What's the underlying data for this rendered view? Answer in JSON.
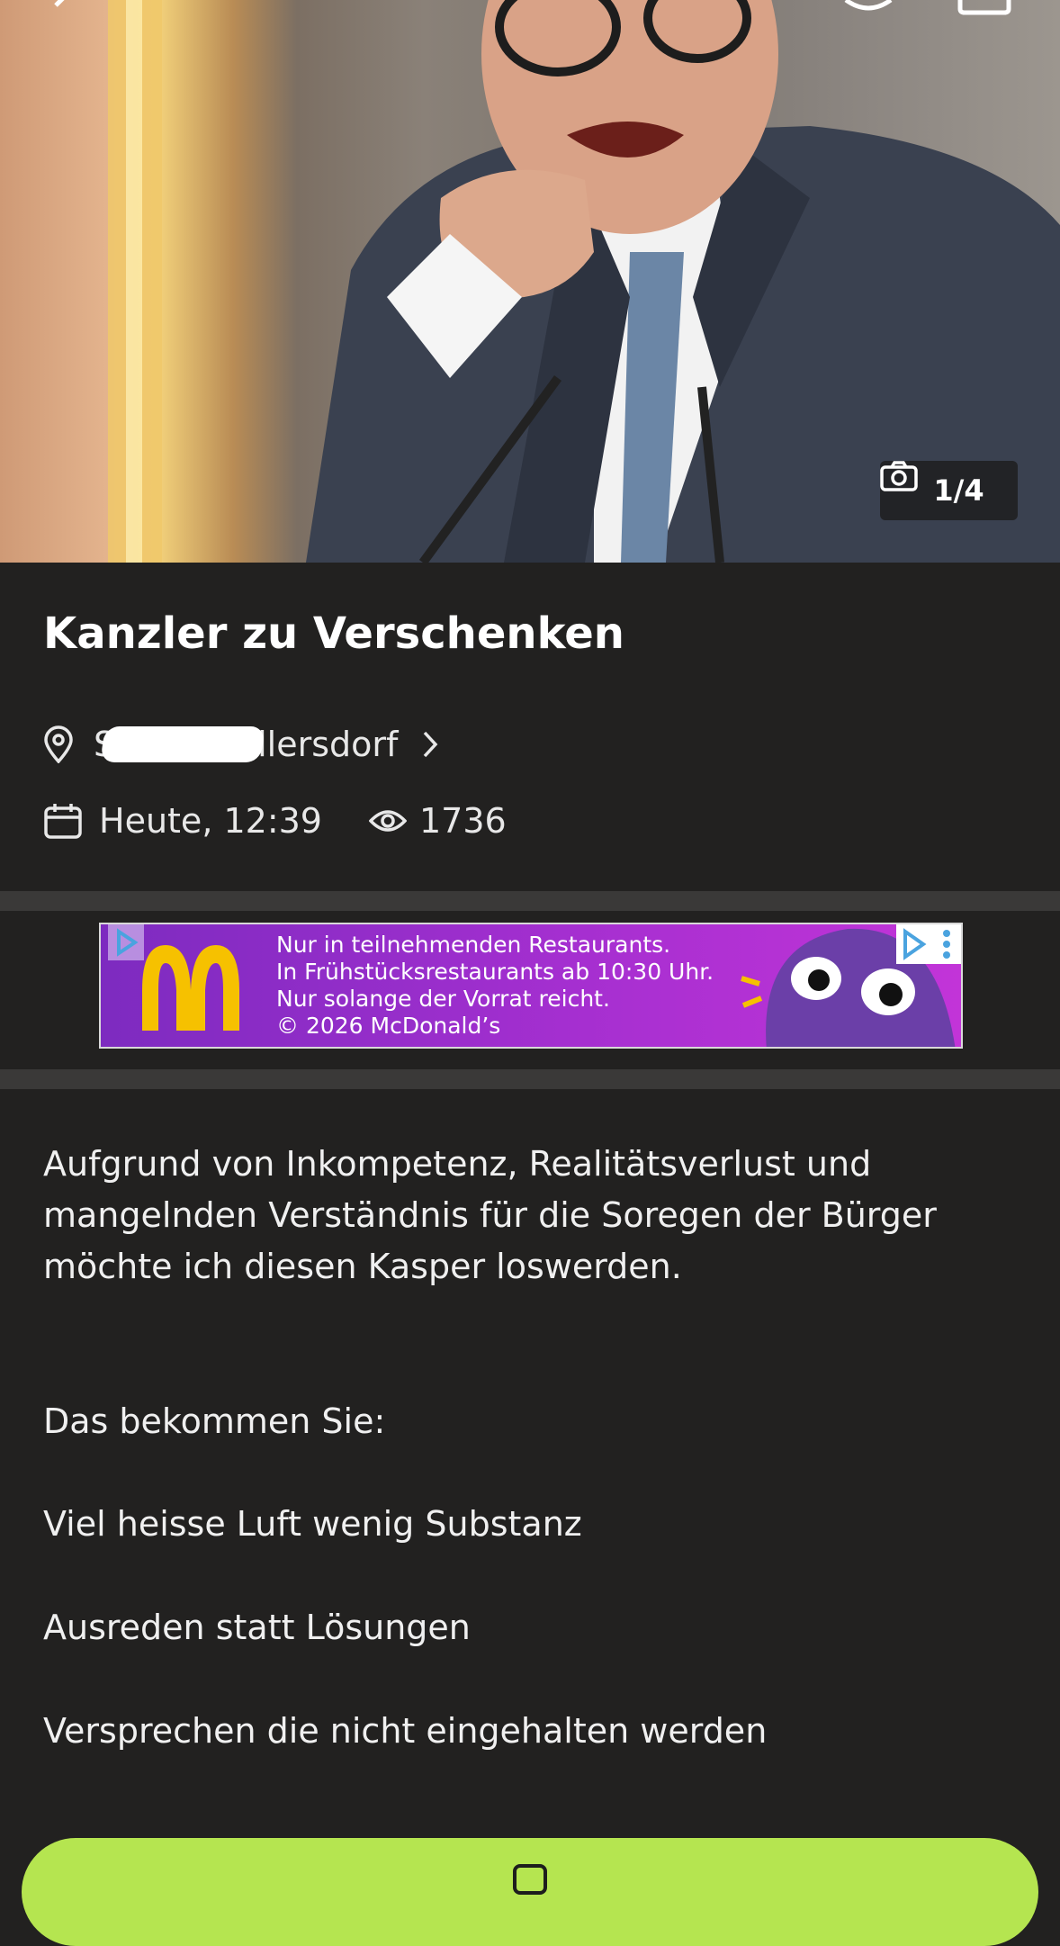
{
  "gallery": {
    "counter": "1/4",
    "icons": [
      "back-arrow-icon",
      "heart-icon",
      "share-icon",
      "camera-icon"
    ]
  },
  "listing": {
    "title": "Kanzler zu Verschenken",
    "location_prefix": "S",
    "location_suffix": "llersdorf",
    "date": "Heute, 12:39",
    "views": "1736"
  },
  "ad": {
    "lines": [
      "Nur in teilnehmenden Restaurants.",
      "In Frühstücksrestaurants ab 10:30 Uhr.",
      "Nur solange der Vorrat reicht.",
      "© 2026 McDonald’s"
    ],
    "colors": {
      "background": "#a52fd0",
      "logo": "#f6c100"
    }
  },
  "description": {
    "intro": "Aufgrund von Inkompetenz, Realitätsverlust und mangelnden Verständnis für die Soregen der Bürger möchte ich diesen Kasper loswerden.",
    "heading": "Das bekommen Sie:",
    "items": [
      "Viel heisse Luft wenig Substanz",
      "Ausreden statt Lösungen",
      "Versprechen die nicht eingehalten werden"
    ]
  },
  "colors": {
    "background": "#222120",
    "accent": "#b5e550"
  }
}
